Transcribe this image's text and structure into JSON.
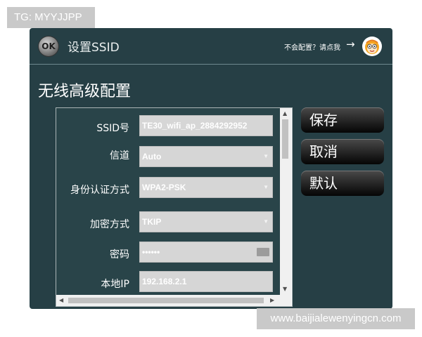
{
  "watermarks": {
    "top": "TG: MYYJJPP",
    "bottom": "www.baijialewenyingcn.com"
  },
  "titlebar": {
    "ok_icon_text": "OK",
    "title": "设置SSID",
    "help_text": "不会配置？请点我",
    "help_arrow": "→"
  },
  "page_title": "无线高级配置",
  "form": {
    "ssid": {
      "label": "SSID号",
      "value": "TE30_wifi_ap_2884292952"
    },
    "channel": {
      "label": "信道",
      "value": "Auto"
    },
    "auth": {
      "label": "身份认证方式",
      "value": "WPA2-PSK"
    },
    "encryption": {
      "label": "加密方式",
      "value": "TKIP"
    },
    "password": {
      "label": "密码",
      "value": "••••••"
    },
    "local_ip": {
      "label": "本地IP",
      "value": "192.168.2.1"
    }
  },
  "buttons": {
    "save": "保存",
    "cancel": "取消",
    "default": "默认"
  },
  "icons": {
    "ok": "ok-icon",
    "help_arrow": "arrow-right-icon",
    "avatar": "cartoon-face-icon",
    "caret": "chevron-down-icon",
    "keyboard": "keyboard-icon"
  },
  "colors": {
    "panel": "#263f45",
    "form": "#294449",
    "input": "#d6d6d6",
    "button": "#1a1a1a"
  }
}
